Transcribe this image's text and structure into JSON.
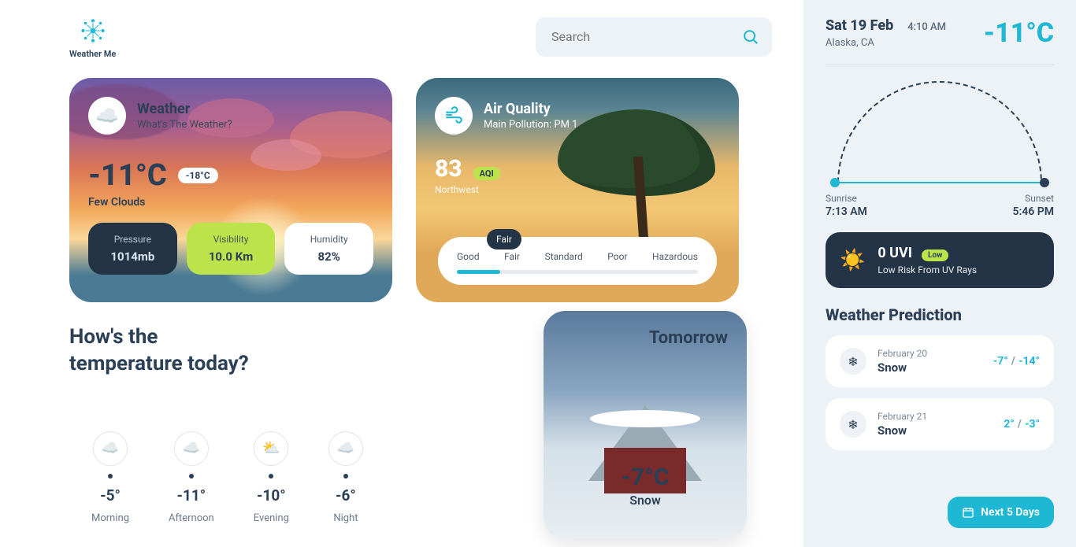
{
  "logo": {
    "text": "Weather Me"
  },
  "search": {
    "placeholder": "Search"
  },
  "weather_card": {
    "title": "Weather",
    "subtitle": "What's The Weather?",
    "temp": "-11°C",
    "temp_alt": "-18°C",
    "desc": "Few Clouds",
    "stats": {
      "pressure": {
        "label": "Pressure",
        "value": "1014mb"
      },
      "visibility": {
        "label": "Visibility",
        "value": "10.0 Km"
      },
      "humidity": {
        "label": "Humidity",
        "value": "82%"
      }
    }
  },
  "aq_card": {
    "title": "Air Quality",
    "subtitle": "Main Pollution: PM 1",
    "value": "83",
    "badge": "AQI",
    "direction": "Northwest",
    "levels": [
      "Good",
      "Fair",
      "Standard",
      "Poor",
      "Hazardous"
    ],
    "current_level": "Fair"
  },
  "today": {
    "heading_line1": "How's the",
    "heading_line2": "temperature today?",
    "slots": [
      {
        "temp": "-5°",
        "label": "Morning"
      },
      {
        "temp": "-11°",
        "label": "Afternoon"
      },
      {
        "temp": "-10°",
        "label": "Evening"
      },
      {
        "temp": "-6°",
        "label": "Night"
      }
    ]
  },
  "tomorrow": {
    "title": "Tomorrow",
    "temp": "-7°C",
    "desc": "Snow"
  },
  "sidebar": {
    "date": "Sat 19 Feb",
    "time": "4:10 AM",
    "location": "Alaska, CA",
    "temp": "-11°C",
    "sunrise": {
      "label": "Sunrise",
      "time": "7:13 AM"
    },
    "sunset": {
      "label": "Sunset",
      "time": "5:46 PM"
    },
    "uvi": {
      "title": "0 UVI",
      "badge": "Low",
      "sub": "Low Risk From UV Rays"
    },
    "pred_title": "Weather Prediction",
    "predictions": [
      {
        "date": "February 20",
        "cond": "Snow",
        "hi": "-7°",
        "lo": "-14°"
      },
      {
        "date": "February 21",
        "cond": "Snow",
        "hi": "2°",
        "lo": "-3°"
      }
    ],
    "next5": "Next 5 Days"
  }
}
